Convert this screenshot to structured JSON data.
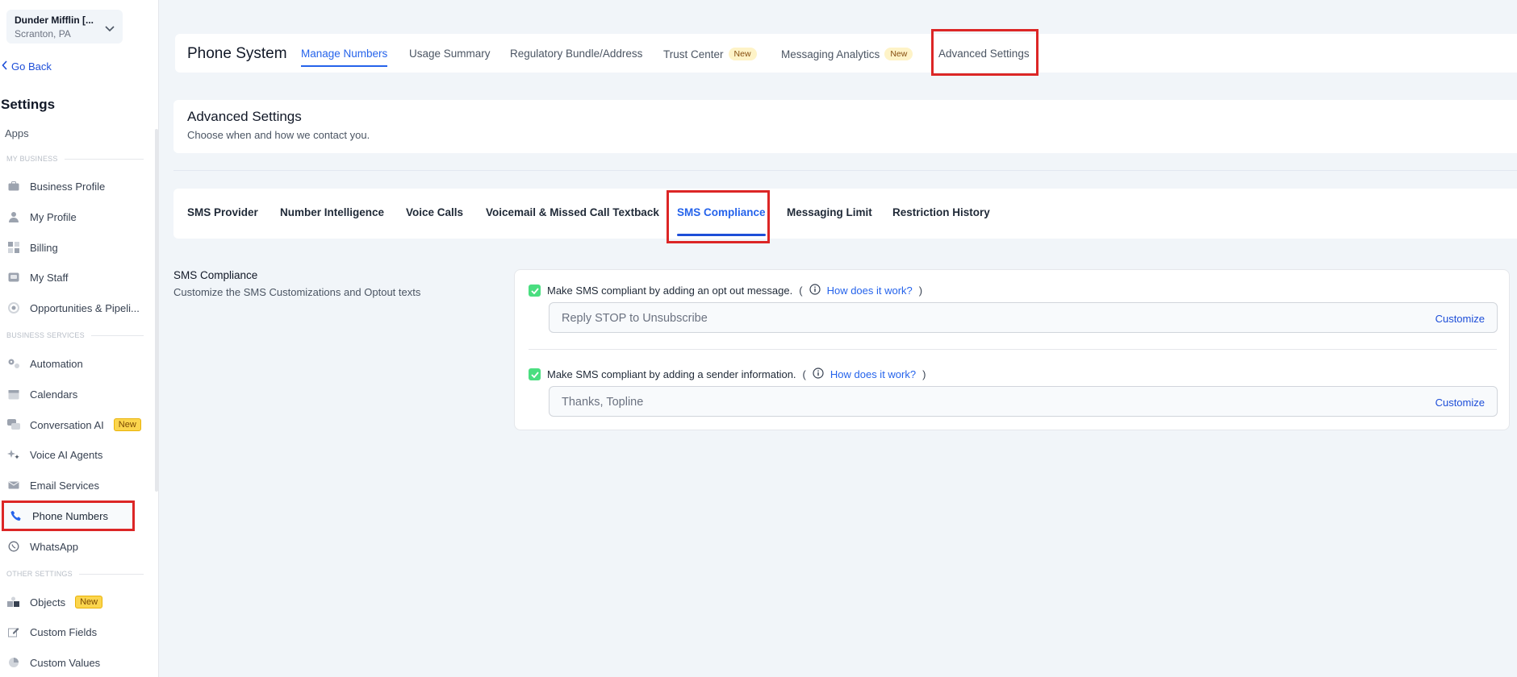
{
  "location": {
    "name": "Dunder Mifflin [...",
    "address": "Scranton, PA"
  },
  "sidebar": {
    "go_back": "Go Back",
    "title": "Settings",
    "apps": "Apps",
    "sections": {
      "my_business": "MY BUSINESS",
      "business_services": "BUSINESS SERVICES",
      "other_settings": "OTHER SETTINGS"
    },
    "items": [
      {
        "label": "Business Profile"
      },
      {
        "label": "My Profile"
      },
      {
        "label": "Billing"
      },
      {
        "label": "My Staff"
      },
      {
        "label": "Opportunities & Pipeli..."
      },
      {
        "label": "Automation"
      },
      {
        "label": "Calendars"
      },
      {
        "label": "Conversation AI",
        "badge": "New"
      },
      {
        "label": "Voice AI Agents"
      },
      {
        "label": "Email Services"
      },
      {
        "label": "Phone Numbers"
      },
      {
        "label": "WhatsApp"
      },
      {
        "label": "Objects",
        "badge": "New"
      },
      {
        "label": "Custom Fields"
      },
      {
        "label": "Custom Values"
      }
    ]
  },
  "header": {
    "title": "Phone System",
    "tabs": [
      {
        "label": "Manage Numbers"
      },
      {
        "label": "Usage Summary"
      },
      {
        "label": "Regulatory Bundle/Address"
      },
      {
        "label": "Trust Center",
        "badge": "New"
      },
      {
        "label": "Messaging Analytics",
        "badge": "New"
      },
      {
        "label": "Advanced Settings"
      }
    ]
  },
  "advanced": {
    "title": "Advanced Settings",
    "subtitle": "Choose when and how we contact you."
  },
  "subtabs": [
    {
      "label": "SMS Provider"
    },
    {
      "label": "Number Intelligence"
    },
    {
      "label": "Voice Calls"
    },
    {
      "label": "Voicemail & Missed Call Textback"
    },
    {
      "label": "SMS Compliance"
    },
    {
      "label": "Messaging Limit"
    },
    {
      "label": "Restriction History"
    }
  ],
  "compliance": {
    "title": "SMS Compliance",
    "description": "Customize the SMS Customizations and Optout texts",
    "optout": {
      "label": "Make SMS compliant by adding an opt out message.",
      "how": "How does it work?",
      "value": "Reply STOP to Unsubscribe",
      "customize": "Customize"
    },
    "sender": {
      "label": "Make SMS compliant by adding a sender information.",
      "how": "How does it work?",
      "value": "Thanks, Topline",
      "customize": "Customize"
    }
  },
  "colors": {
    "accent": "#2563eb",
    "highlight": "#dc2626",
    "check": "#4ade80"
  }
}
